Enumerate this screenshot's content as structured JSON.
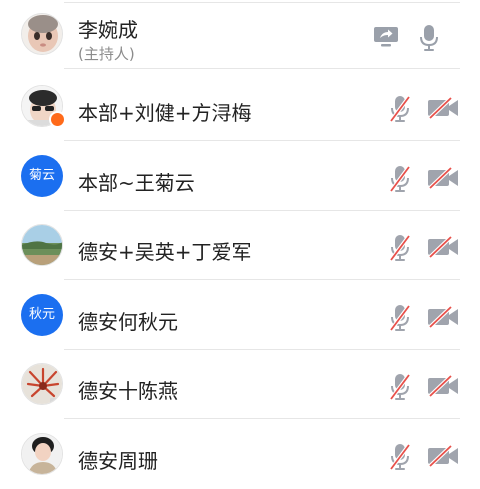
{
  "host": {
    "name": "李婉成",
    "role": "(主持人)",
    "icons": [
      "screen-share-icon",
      "microphone-icon"
    ]
  },
  "participants": [
    {
      "name": "本部+刘健+方浔梅",
      "avatar_type": "photo",
      "avatar_text": "",
      "mic": "muted",
      "camera": "off"
    },
    {
      "name": "本部~王菊云",
      "avatar_type": "text",
      "avatar_text": "菊云",
      "mic": "muted",
      "camera": "off"
    },
    {
      "name": "德安+吴英+丁爱军",
      "avatar_type": "photo",
      "avatar_text": "",
      "mic": "muted",
      "camera": "off"
    },
    {
      "name": "德安何秋元",
      "avatar_type": "text",
      "avatar_text": "秋元",
      "mic": "muted",
      "camera": "off"
    },
    {
      "name": "德安十陈燕",
      "avatar_type": "photo",
      "avatar_text": "",
      "mic": "muted",
      "camera": "off"
    },
    {
      "name": "德安周珊",
      "avatar_type": "photo",
      "avatar_text": "",
      "mic": "muted",
      "camera": "off"
    }
  ],
  "colors": {
    "text_avatar_bg": "#1b6ff0",
    "icon_gray": "#a0a4ad",
    "mute_slash_red": "#e8504a"
  }
}
